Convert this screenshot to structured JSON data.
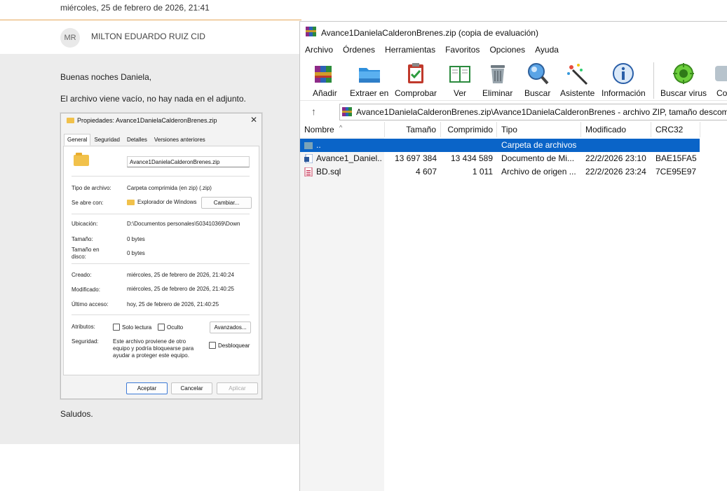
{
  "email": {
    "date": "miércoles, 25 de febrero de 2026, 21:41",
    "avatar_initials": "MR",
    "sender": "MILTON EDUARDO RUIZ CID",
    "greeting": "Buenas noches Daniela,",
    "message": "El archivo viene vacío, no hay nada en el adjunto.",
    "closing": "Saludos.",
    "colors": {
      "header_border": "#e6a75a",
      "body_bg": "#ececec"
    }
  },
  "properties_dialog": {
    "title": "Propiedades: Avance1DanielaCalderonBrenes.zip",
    "close_glyph": "✕",
    "tabs": [
      "General",
      "Seguridad",
      "Detalles",
      "Versiones anteriores"
    ],
    "file_name": "Avance1DanielaCalderonBrenes.zip",
    "tipo_label": "Tipo de archivo:",
    "tipo_value": "Carpeta comprimida (en zip) (.zip)",
    "abre_label": "Se abre con:",
    "abre_value": "Explorador de Windows",
    "cambiar_button": "Cambiar...",
    "ubicacion_label": "Ubicación:",
    "ubicacion_value": "D:\\Documentos personales\\503410369\\Down",
    "tamano_label": "Tamaño:",
    "tamano_value": "0 bytes",
    "tamano_disco_label_1": "Tamaño en",
    "tamano_disco_label_2": "disco:",
    "tamano_disco_value": "0 bytes",
    "creado_label": "Creado:",
    "creado_value": "miércoles, 25 de febrero de 2026, 21:40:24",
    "modificado_label": "Modificado:",
    "modificado_value": "miércoles, 25 de febrero de 2026, 21:40:25",
    "acceso_label": "Último acceso:",
    "acceso_value": "hoy, 25 de febrero de 2026, 21:40:25",
    "atributos_label": "Atributos:",
    "solo_lectura": "Solo lectura",
    "oculto": "Oculto",
    "avanzados_button": "Avanzados...",
    "seguridad_label": "Seguridad:",
    "seguridad_line1": "Este archivo proviene de otro",
    "seguridad_line2": "equipo y podría bloquearse para",
    "seguridad_line3": "ayudar a proteger este equipo.",
    "desbloquear": "Desbloquear",
    "aceptar": "Aceptar",
    "cancelar": "Cancelar",
    "aplicar": "Aplicar"
  },
  "winrar": {
    "title": "Avance1DanielaCalderonBrenes.zip (copia de evaluación)",
    "menu": [
      "Archivo",
      "Órdenes",
      "Herramientas",
      "Favoritos",
      "Opciones",
      "Ayuda"
    ],
    "toolbar": [
      {
        "label": "Añadir",
        "icon": "add-books-icon"
      },
      {
        "label": "Extraer en",
        "icon": "extract-folder-icon"
      },
      {
        "label": "Comprobar",
        "icon": "test-clipboard-icon"
      },
      {
        "label": "Ver",
        "icon": "view-book-icon"
      },
      {
        "label": "Eliminar",
        "icon": "trash-icon"
      },
      {
        "label": "Buscar",
        "icon": "magnifier-icon"
      },
      {
        "label": "Asistente",
        "icon": "wizard-wand-icon"
      },
      {
        "label": "Información",
        "icon": "info-icon"
      },
      {
        "label": "Buscar virus",
        "icon": "virus-scan-icon"
      },
      {
        "label": "Con",
        "icon": "comment-icon"
      }
    ],
    "address": "Avance1DanielaCalderonBrenes.zip\\Avance1DanielaCalderonBrenes - archivo ZIP, tamaño descompr",
    "up_glyph": "↑",
    "sort_caret": "^",
    "columns": [
      "Nombre",
      "Tamaño",
      "Comprimido",
      "Tipo",
      "Modificado",
      "CRC32"
    ],
    "rows": [
      {
        "name": "..",
        "size": "",
        "packed": "",
        "type": "Carpeta de archivos",
        "modified": "",
        "crc": "",
        "selected": true
      },
      {
        "name": "Avance1_Daniel...",
        "size": "13 697 384",
        "packed": "13 434 589",
        "type": "Documento de Mi...",
        "modified": "22/2/2026 23:10",
        "crc": "BAE15FA5",
        "selected": false
      },
      {
        "name": "BD.sql",
        "size": "4 607",
        "packed": "1 011",
        "type": "Archivo de origen ...",
        "modified": "22/2/2026 23:24",
        "crc": "7CE95E97",
        "selected": false
      }
    ],
    "colors": {
      "selection": "#0a64c8"
    }
  }
}
